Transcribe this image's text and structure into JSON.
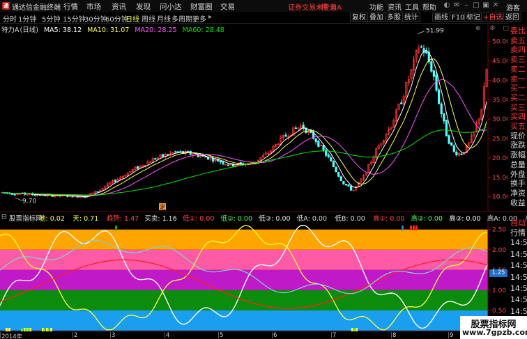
{
  "menubar": {
    "logo": "通",
    "app_title": "通达信金融终端",
    "menus": [
      "行情",
      "市场",
      "资讯",
      "发现",
      "问小达",
      "财富圈",
      "交易"
    ],
    "warning": "证券交易未登录",
    "symbol": "特 力A",
    "buttons": [
      "功能",
      "资讯",
      "工具",
      "帮助"
    ],
    "user": "游客"
  },
  "periodbar": {
    "periods": [
      "分时",
      "1分钟",
      "5分钟",
      "15分钟",
      "30分钟",
      "60分钟",
      "日线",
      "周线",
      "月线",
      "多周期",
      "更多"
    ],
    "active": "日线",
    "tools": [
      "复权",
      "叠加",
      "多股",
      "统计",
      "画线",
      "F10",
      "标记",
      "+自选",
      "返回"
    ]
  },
  "main": {
    "header": {
      "stock": "特力A",
      "period": "(日线)",
      "ma5": "MA5: 38.12",
      "ma10": "MA10: 31.07",
      "ma20": "MA20: 28.25",
      "ma60": "MA60: 28.48"
    },
    "high_label": "51.99",
    "low_label": "9.70",
    "marker": "定",
    "year_label": "2014年"
  },
  "chart_data": {
    "type": "candlestick",
    "price_axis": {
      "labels": [
        "50.00",
        "45.00",
        "40.00",
        "35.00",
        "30.00",
        "25.00",
        "20.00",
        "15.00",
        "10.00"
      ],
      "range": [
        8.5,
        53
      ]
    },
    "high": 51.99,
    "low": 9.7,
    "indicator": {
      "name": "股票指标网",
      "fields": [
        {
          "k": "地",
          "v": "0.02",
          "c": "#ffff54"
        },
        {
          "k": "天",
          "v": "0.71",
          "c": "#ffff54"
        },
        {
          "k": "趋势",
          "v": "1.47",
          "c": "#ff4a4a"
        },
        {
          "k": "买卖",
          "v": "1.16",
          "c": "#e8e8e8"
        },
        {
          "k": "低①",
          "v": "0.00",
          "c": "#ff4a4a"
        },
        {
          "k": "低②",
          "v": "0.00",
          "c": "#54ff54"
        },
        {
          "k": "低③",
          "v": "0.00",
          "c": "#e8e8e8"
        },
        {
          "k": "低A",
          "v": "0.00",
          "c": "#dddddd"
        },
        {
          "k": "低B",
          "v": "0.00",
          "c": "#dddddd"
        },
        {
          "k": "高①",
          "v": "0.00",
          "c": "#ff4a4a"
        },
        {
          "k": "高②",
          "v": "0.00",
          "c": "#54ff54"
        },
        {
          "k": "高③",
          "v": "0.00",
          "c": "#ffffff"
        },
        {
          "k": "高A",
          "v": "0.00",
          "c": "#dddddd"
        },
        {
          "k": "高B",
          "v": "0.00",
          "c": "#dddddd"
        }
      ],
      "axis_labels": [
        "2.50",
        "2.00",
        "1.50",
        "1.00",
        "0.50"
      ],
      "range": [
        0.0,
        2.65
      ],
      "current_value_label": "1.25",
      "bands": [
        {
          "from": 2.0,
          "to": 2.5,
          "color": "#ffa500"
        },
        {
          "from": 1.5,
          "to": 2.0,
          "color": "#ff5aa6"
        },
        {
          "from": 1.0,
          "to": 1.5,
          "color": "#c01ac8"
        },
        {
          "from": 0.5,
          "to": 1.0,
          "color": "#0c8c0c"
        },
        {
          "from": 0.0,
          "to": 0.5,
          "color": "#1a9ef0"
        }
      ]
    },
    "date_labels": [
      "2014年",
      "2",
      "3",
      "4",
      "5",
      "6",
      "7",
      "8",
      "9"
    ]
  },
  "sidebar": {
    "items": [
      "委比",
      "卖五",
      "卖四",
      "卖三",
      "卖二",
      "卖一",
      "买一",
      "买二",
      "买三",
      "买四",
      "买五",
      "现价",
      "涨跌",
      "涨幅",
      "总量",
      "外盘",
      "换手",
      "净资",
      "收益"
    ]
  },
  "sidebar2": {
    "items": [
      "行情",
      "14:56",
      "14:56",
      "14:56",
      "14:56",
      "14:56",
      "14:56",
      "14:56",
      "14:56"
    ],
    "label": "自动"
  },
  "watermark": {
    "line1": "股票指标网",
    "line2": "www.7gpzb.com"
  },
  "colors": {
    "up": "#ff3232",
    "down": "#54ffff",
    "ma5": "#ffffff",
    "ma10": "#ffff54",
    "ma20": "#ff54ff",
    "ma60": "#00e600"
  }
}
